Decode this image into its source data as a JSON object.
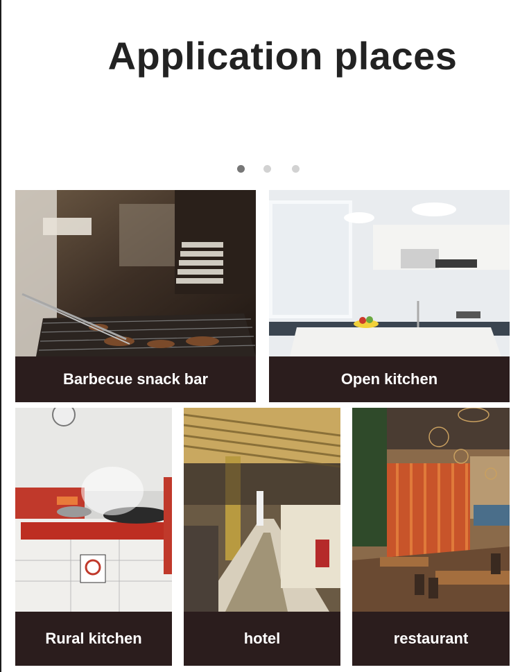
{
  "page": {
    "title": "Application places"
  },
  "carousel": {
    "dots": 3,
    "active_index": 0
  },
  "cards": [
    {
      "label": "Barbecue snack bar",
      "photo": "barbecue-grill-photo"
    },
    {
      "label": "Open kitchen",
      "photo": "open-kitchen-photo"
    },
    {
      "label": "Rural kitchen",
      "photo": "rural-kitchen-photo"
    },
    {
      "label": "hotel",
      "photo": "hotel-buffet-photo"
    },
    {
      "label": "restaurant",
      "photo": "restaurant-dining-photo"
    }
  ]
}
